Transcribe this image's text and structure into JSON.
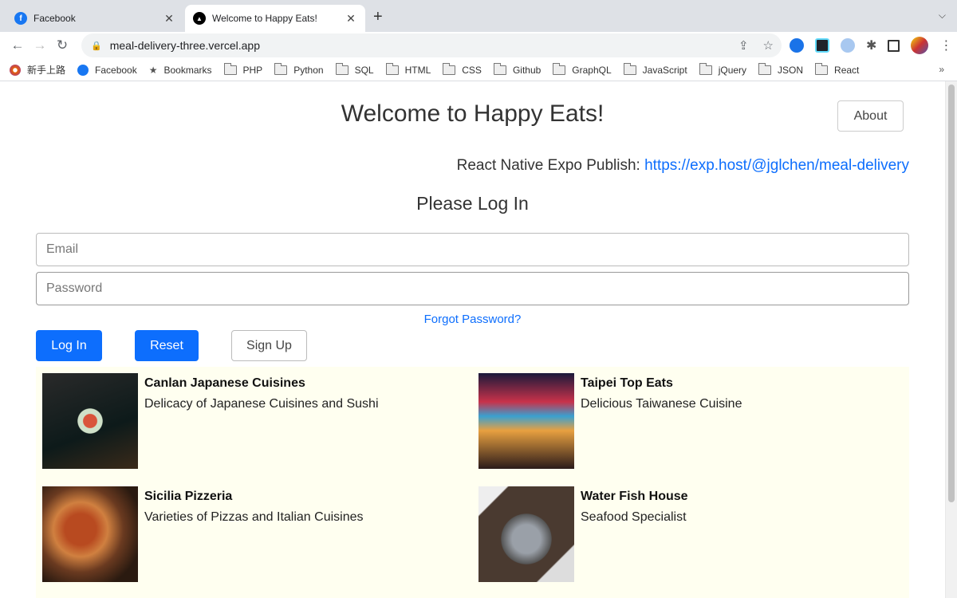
{
  "browser": {
    "tabs": [
      {
        "title": "Facebook",
        "icon": "facebook-icon",
        "active": false
      },
      {
        "title": "Welcome to Happy Eats!",
        "icon": "vercel-icon",
        "active": true
      }
    ],
    "new_tab": "+",
    "tab_menu": "⌄",
    "url": "meal-delivery-three.vercel.app",
    "bookmarks": [
      {
        "label": "新手上路",
        "icon": "firefox-icon"
      },
      {
        "label": "Facebook",
        "icon": "facebook-icon"
      },
      {
        "label": "Bookmarks",
        "icon": "star-icon"
      },
      {
        "label": "PHP",
        "icon": "folder-icon"
      },
      {
        "label": "Python",
        "icon": "folder-icon"
      },
      {
        "label": "SQL",
        "icon": "folder-icon"
      },
      {
        "label": "HTML",
        "icon": "folder-icon"
      },
      {
        "label": "CSS",
        "icon": "folder-icon"
      },
      {
        "label": "Github",
        "icon": "folder-icon"
      },
      {
        "label": "GraphQL",
        "icon": "folder-icon"
      },
      {
        "label": "JavaScript",
        "icon": "folder-icon"
      },
      {
        "label": "jQuery",
        "icon": "folder-icon"
      },
      {
        "label": "JSON",
        "icon": "folder-icon"
      },
      {
        "label": "React",
        "icon": "folder-icon"
      }
    ],
    "more": "»"
  },
  "header": {
    "title": "Welcome to Happy Eats!",
    "about_label": "About",
    "expo_label": "React Native Expo Publish:",
    "expo_link": "https://exp.host/@jglchen/meal-delivery"
  },
  "login": {
    "heading": "Please Log In",
    "email_placeholder": "Email",
    "password_placeholder": "Password",
    "forgot": "Forgot Password?",
    "login_label": "Log In",
    "reset_label": "Reset",
    "signup_label": "Sign Up"
  },
  "restaurants": [
    {
      "name": "Canlan Japanese Cuisines",
      "desc": "Delicacy of Japanese Cuisines and Sushi"
    },
    {
      "name": "Taipei Top Eats",
      "desc": "Delicious Taiwanese Cuisine"
    },
    {
      "name": "Sicilia Pizzeria",
      "desc": "Varieties of Pizzas and Italian Cuisines"
    },
    {
      "name": "Water Fish House",
      "desc": "Seafood Specialist"
    }
  ],
  "colors": {
    "primary": "#0d6efd",
    "list_bg": "#fffff0"
  }
}
